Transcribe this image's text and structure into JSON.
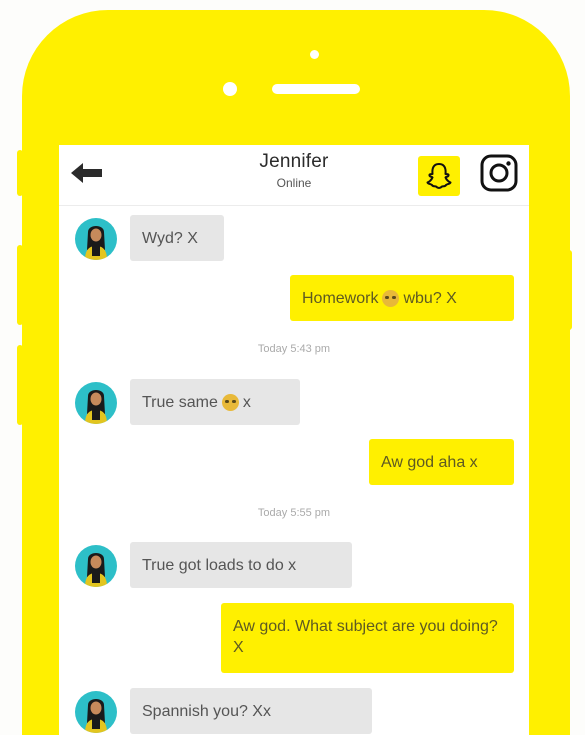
{
  "header": {
    "contact_name": "Jennifer",
    "status": "Online",
    "back_icon": "arrow-left-icon",
    "snapchat_icon": "snapchat-ghost-icon",
    "instagram_icon": "instagram-icon"
  },
  "messages": [
    {
      "from": "them",
      "text": "Wyd? X"
    },
    {
      "from": "me",
      "text_before": "Homework",
      "emoji": "grimace-emoji",
      "text_after": "wbu? X"
    },
    {
      "from": "system",
      "text": "Today 5:43 pm"
    },
    {
      "from": "them",
      "text_before": "True same",
      "emoji": "laughing-emoji",
      "text_after": "x"
    },
    {
      "from": "me",
      "text": "Aw god aha x"
    },
    {
      "from": "system",
      "text": "Today 5:55 pm"
    },
    {
      "from": "them",
      "text": "True got loads to do x"
    },
    {
      "from": "me",
      "text": "Aw god. What subject are you doing? X"
    },
    {
      "from": "them",
      "text": "Spannish you? Xx"
    }
  ],
  "colors": {
    "snapchat_yellow": "#FFF000",
    "incoming_bubble": "#E6E6E6",
    "avatar_bg": "#2DBFC8"
  }
}
